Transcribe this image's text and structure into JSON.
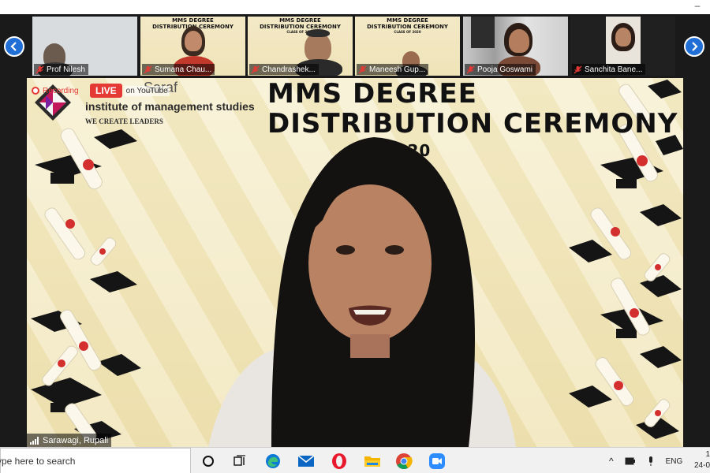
{
  "gallery": {
    "participants": [
      {
        "name": "Prof Nilesh"
      },
      {
        "name": "Sumana Chau..."
      },
      {
        "name": "Chandrashek..."
      },
      {
        "name": "Maneesh Gup..."
      },
      {
        "name": "Pooja Goswami"
      },
      {
        "name": "Sanchita Bane..."
      }
    ],
    "mini_banner": {
      "line1": "MMS DEGREE",
      "line2": "DISTRIBUTION CEREMONY",
      "line3": "CLASS OF 2020"
    }
  },
  "main": {
    "recording_label": "Recording",
    "live_label": "LIVE",
    "live_platform": "on YouTube",
    "institute": {
      "name_faint": "Saraf",
      "name": "institute of management studies",
      "slogan": "WE CREATE LEADERS"
    },
    "banner": {
      "line1": "MMS DEGREE",
      "line2": "DISTRIBUTION CEREMONY",
      "line3": "E 2020"
    },
    "speaker_name": "Sarawagi, Rupali"
  },
  "taskbar": {
    "search_placeholder": "ype here to search",
    "language": "ENG",
    "time": "1",
    "date": "24-0"
  },
  "colors": {
    "accent_blue": "#1f6fd6",
    "live_red": "#e53935",
    "banner_cream": "#f4ecc9"
  }
}
